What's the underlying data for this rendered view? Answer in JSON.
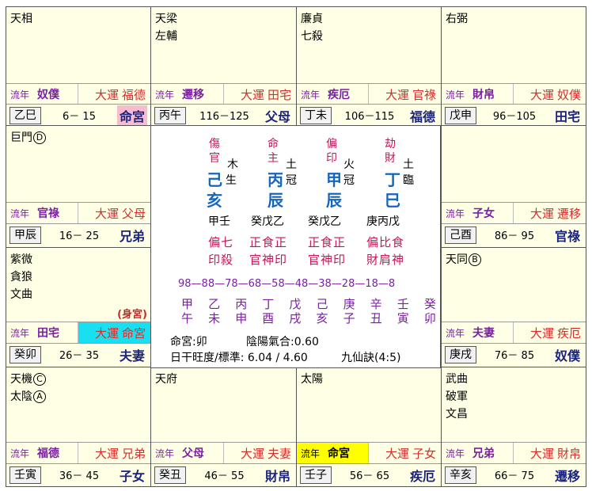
{
  "labels": {
    "liunian": "流年",
    "dayun": "大運",
    "shengong": "(身宮)"
  },
  "cells": [
    {
      "id": "si",
      "stars": [
        "天相"
      ],
      "ln": "奴僕",
      "dy": "福德",
      "gz": "乙巳",
      "age": "6－ 15",
      "pal": "命宮"
    },
    {
      "id": "wu",
      "stars": [
        "天梁",
        "左輔"
      ],
      "ln": "遷移",
      "dy": "田宅",
      "gz": "丙午",
      "age": "116－125",
      "pal": "父母"
    },
    {
      "id": "wei",
      "stars": [
        "廉貞",
        "七殺"
      ],
      "ln": "疾厄",
      "dy": "官祿",
      "gz": "丁未",
      "age": "106－115",
      "pal": "福德"
    },
    {
      "id": "shen",
      "stars": [
        "右弼"
      ],
      "ln": "財帛",
      "dy": "奴僕",
      "gz": "戊申",
      "age": "96－105",
      "pal": "田宅"
    },
    {
      "id": "chen",
      "stars": [
        "巨門"
      ],
      "ln": "官祿",
      "dy": "父母",
      "gz": "甲辰",
      "age": "16－ 25",
      "pal": "兄弟"
    },
    {
      "id": "you",
      "stars": [],
      "ln": "子女",
      "dy": "遷移",
      "gz": "己酉",
      "age": "86－ 95",
      "pal": "官祿"
    },
    {
      "id": "mao",
      "stars": [
        "紫微",
        "貪狼",
        "文曲"
      ],
      "ln": "田宅",
      "dy": "命宮",
      "gz": "癸卯",
      "age": "26－ 35",
      "pal": "夫妻"
    },
    {
      "id": "xu",
      "stars": [
        "天同"
      ],
      "ln": "夫妻",
      "dy": "疾厄",
      "gz": "庚戌",
      "age": "76－ 85",
      "pal": "奴僕"
    },
    {
      "id": "yin",
      "stars": [
        "天機",
        "太陰"
      ],
      "ln": "福德",
      "dy": "兄弟",
      "gz": "壬寅",
      "age": "36－ 45",
      "pal": "子女"
    },
    {
      "id": "chou",
      "stars": [
        "天府"
      ],
      "ln": "父母",
      "dy": "夫妻",
      "gz": "癸丑",
      "age": "46－ 55",
      "pal": "財帛"
    },
    {
      "id": "zi",
      "stars": [
        "太陽"
      ],
      "ln": "命宮",
      "dy": "子女",
      "gz": "壬子",
      "age": "56－ 65",
      "pal": "疾厄"
    },
    {
      "id": "hai",
      "stars": [
        "武曲",
        "破軍",
        "文昌"
      ],
      "ln": "兄弟",
      "dy": "財帛",
      "gz": "辛亥",
      "age": "66－ 75",
      "pal": "遷移"
    }
  ],
  "sihua": {
    "chen": "D",
    "you": "B",
    "yin": "C",
    "yin2": "A"
  },
  "center": {
    "pillars": [
      {
        "god1": "傷",
        "god2": "官",
        "elem": "木",
        "stem": "己",
        "phase": "生",
        "branch": "亥",
        "hidden": "甲壬",
        "hgod1": "偏七",
        "hgod2": "印殺"
      },
      {
        "god1": "命",
        "god2": "主",
        "elem": "土",
        "stem": "丙",
        "phase": "冠",
        "branch": "辰",
        "hidden": "癸戊乙",
        "hgod1": "正食正",
        "hgod2": "官神印"
      },
      {
        "god1": "偏",
        "god2": "印",
        "elem": "火",
        "stem": "甲",
        "phase": "冠",
        "branch": "辰",
        "hidden": "癸戊乙",
        "hgod1": "正食正",
        "hgod2": "官神印"
      },
      {
        "god1": "劫",
        "god2": "財",
        "elem": "土",
        "stem": "丁",
        "phase": "臨",
        "branch": "巳",
        "hidden": "庚丙戊",
        "hgod1": "偏比食",
        "hgod2": "財肩神"
      }
    ],
    "ageseq": "98—88—78—68—58—48—38—28—18—8",
    "dystems": [
      "甲",
      "乙",
      "丙",
      "丁",
      "戊",
      "己",
      "庚",
      "辛",
      "壬",
      "癸"
    ],
    "dybranches": [
      "午",
      "未",
      "申",
      "酉",
      "戌",
      "亥",
      "子",
      "丑",
      "寅",
      "卯"
    ],
    "info1": "命宮:卯",
    "info2": "陰陽氣合:0.60",
    "info3": "日干旺度/標準: 6.04 / 4.60",
    "info4": "九仙訣(4:5)"
  },
  "colors": {
    "bg": "#ffffe6",
    "pink": "#f8bbd0",
    "cyan": "#18e0f0",
    "yellow": "#ffff00"
  }
}
